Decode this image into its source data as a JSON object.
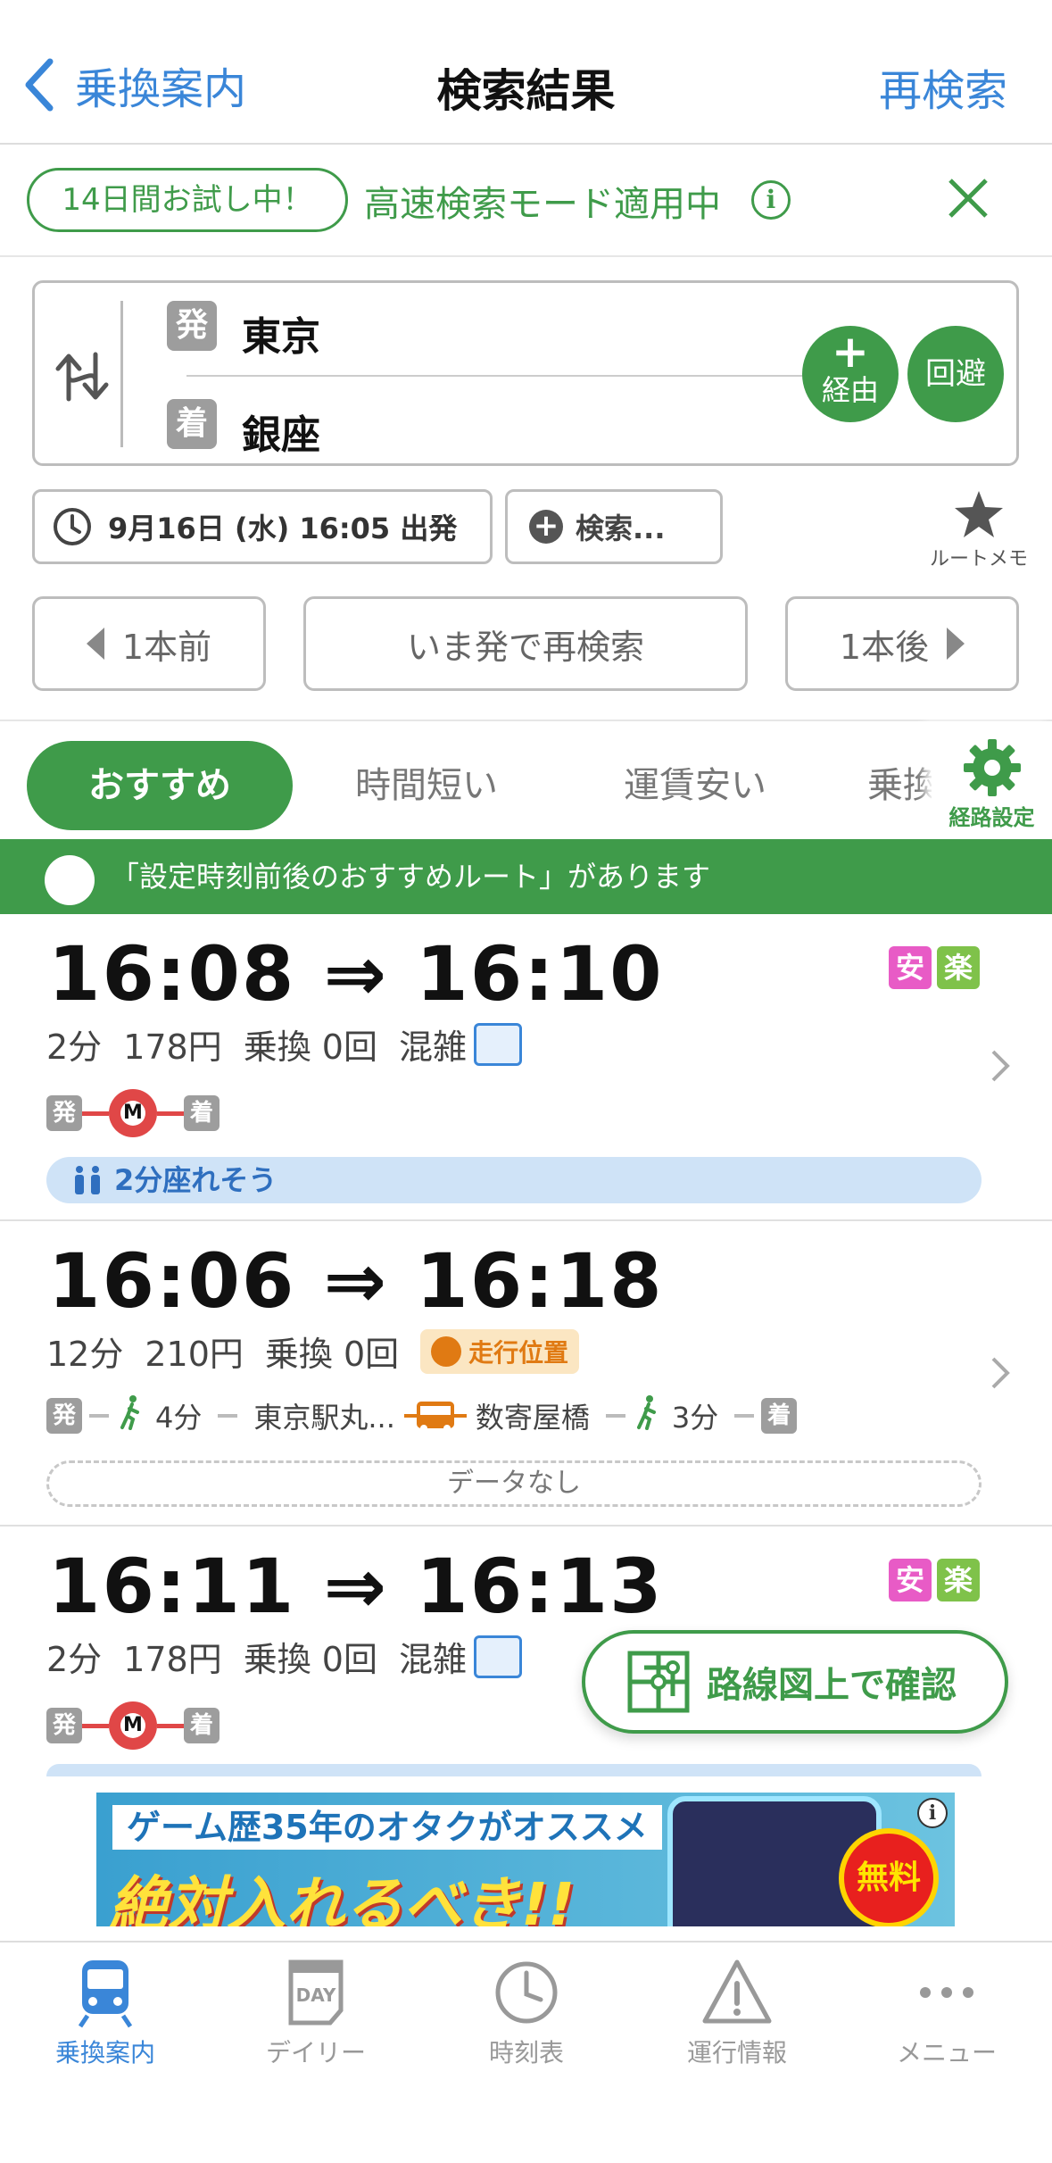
{
  "nav": {
    "back_label": "乗換案内",
    "title": "検索結果",
    "research_label": "再検索"
  },
  "trial": {
    "badge": "14日間お試し中！",
    "text": "高速検索モード適用中"
  },
  "stations": {
    "from_badge": "発",
    "from_name": "東京",
    "to_badge": "着",
    "to_name": "銀座",
    "via_label": "経由",
    "avoid_label": "回避"
  },
  "search": {
    "datetime": "9月16日 (水) 16:05 出発",
    "options_label": "検索...",
    "memo_label": "ルートメモ"
  },
  "nav_row": {
    "prev": "1本前",
    "now": "いま発で再検索",
    "next": "1本後"
  },
  "tabs": [
    {
      "label": "おすすめ",
      "active": true
    },
    {
      "label": "時間短い",
      "active": false
    },
    {
      "label": "運賃安い",
      "active": false
    },
    {
      "label": "乗換回数",
      "active": false
    }
  ],
  "route_setting_label": "経路設定",
  "notice": "「設定時刻前後のおすすめルート」があります",
  "routes": [
    {
      "time": "16:08 ⇒ 16:10",
      "duration": "2分",
      "fare": "178円",
      "transfers": "乗換 0回",
      "crowd": "混雑",
      "tags": [
        "安",
        "楽"
      ],
      "from_badge": "発",
      "to_badge": "着",
      "line_mark": "M",
      "seat": "2分座れそう"
    },
    {
      "time": "16:06 ⇒ 16:18",
      "duration": "12分",
      "fare": "210円",
      "transfers": "乗換 0回",
      "run_position": "走行位置",
      "from_badge": "発",
      "to_badge": "着",
      "walk1": "4分",
      "stop1": "東京駅丸...",
      "stop2": "数寄屋橋",
      "walk2": "3分",
      "no_data": "データなし"
    },
    {
      "time": "16:11 ⇒ 16:13",
      "duration": "2分",
      "fare": "178円",
      "transfers": "乗換 0回",
      "crowd": "混雑",
      "tags": [
        "安",
        "楽"
      ],
      "from_badge": "発",
      "to_badge": "着",
      "line_mark": "M"
    }
  ],
  "map_button": "路線図上で確認",
  "ad": {
    "line1": "ゲーム歴35年のオタクがオススメ",
    "line2": "絶対入れるべき!!",
    "badge": "無料"
  },
  "tabbar": [
    {
      "label": "乗換案内",
      "icon": "train-icon",
      "active": true
    },
    {
      "label": "デイリー",
      "icon": "daily-icon",
      "active": false,
      "icon_text": "DAY"
    },
    {
      "label": "時刻表",
      "icon": "clock-icon",
      "active": false
    },
    {
      "label": "運行情報",
      "icon": "warning-icon",
      "active": false
    },
    {
      "label": "メニュー",
      "icon": "more-icon",
      "active": false
    }
  ],
  "colors": {
    "brand_green": "#3f9b4a",
    "link_blue": "#3a86d8",
    "metro_red": "#e04747"
  }
}
